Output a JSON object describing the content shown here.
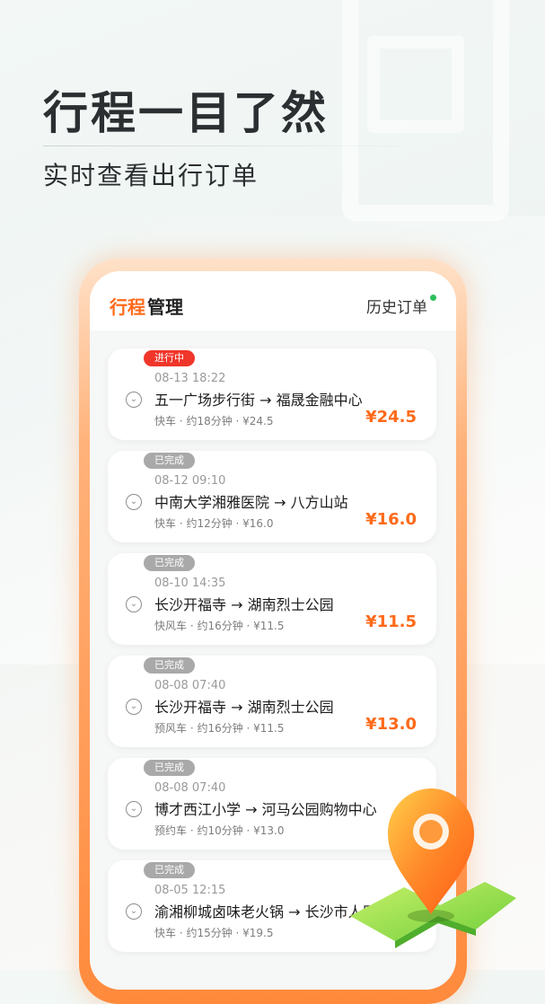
{
  "headline": "行程一目了然",
  "subline": "实时查看出行订单",
  "app": {
    "title_accent": "行程",
    "title_rest": "管理",
    "history_label": "历史订单"
  },
  "colors": {
    "accent": "#ff6a1a",
    "active_badge": "#f0362b",
    "done_badge": "#a9a9a9",
    "online_dot": "#2bbf5a"
  },
  "orders": [
    {
      "status": "进行中",
      "active": true,
      "time": "08-13 18:22",
      "route": "五一广场步行街 → 福晟金融中心",
      "meta": "快车 · 约18分钟 · ¥24.5",
      "price": "¥24.5"
    },
    {
      "status": "已完成",
      "active": false,
      "time": "08-12 09:10",
      "route": "中南大学湘雅医院 → 八方山站",
      "meta": "快车 · 约12分钟 · ¥16.0",
      "price": "¥16.0"
    },
    {
      "status": "已完成",
      "active": false,
      "time": "08-10 14:35",
      "route": "长沙开福寺 → 湖南烈士公园",
      "meta": "快风车 · 约16分钟 · ¥11.5",
      "price": "¥11.5"
    },
    {
      "status": "已完成",
      "active": false,
      "time": "08-08 07:40",
      "route": "长沙开福寺 → 湖南烈士公园",
      "meta": "预风车 · 约16分钟 · ¥11.5",
      "price": "¥13.0"
    },
    {
      "status": "已完成",
      "active": false,
      "time": "08-08 07:40",
      "route": "博才西江小学 → 河马公园购物中心",
      "meta": "预约车 · 约10分钟 · ¥13.0",
      "price": "¥"
    },
    {
      "status": "已完成",
      "active": false,
      "time": "08-05 12:15",
      "route": "渝湘柳城卤味老火锅 → 长沙市人民",
      "meta": "快车 · 约15分钟 · ¥19.5",
      "price": ""
    }
  ]
}
